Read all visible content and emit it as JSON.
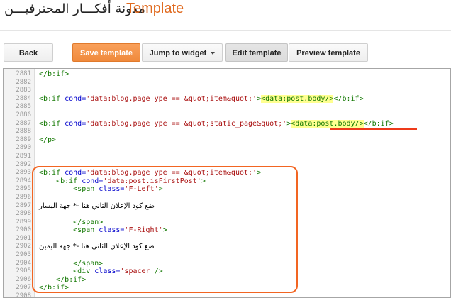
{
  "header": {
    "blog_name": "مدونة أفكـــار المحترفيـــن",
    "separator": "·",
    "page_title": "Template"
  },
  "toolbar": {
    "back_label": "Back",
    "save_label": "Save template",
    "jump_label": "Jump to widget",
    "edit_label": "Edit template",
    "preview_label": "Preview template"
  },
  "editor": {
    "lines": [
      {
        "num": "2881",
        "code": "</b:if>"
      },
      {
        "num": "2882",
        "code": ""
      },
      {
        "num": "2883",
        "code": ""
      },
      {
        "num": "2884",
        "code": "<b:if cond='data:blog.pageType == &quot;item&quot;'><data:post.body/></b:if>"
      },
      {
        "num": "2885",
        "code": ""
      },
      {
        "num": "2886",
        "code": ""
      },
      {
        "num": "2887",
        "code": "<b:if cond='data:blog.pageType == &quot;static_page&quot;'><data:post.body/></b:if>"
      },
      {
        "num": "2888",
        "code": ""
      },
      {
        "num": "2889",
        "code": "</p>"
      },
      {
        "num": "2890",
        "code": ""
      },
      {
        "num": "2891",
        "code": ""
      },
      {
        "num": "2892",
        "code": ""
      },
      {
        "num": "2893",
        "code": "<b:if cond='data:blog.pageType == &quot;item&quot;'>"
      },
      {
        "num": "2894",
        "code": "    <b:if cond='data:post.isFirstPost'>"
      },
      {
        "num": "2895",
        "code": "        <span class='F-Left'>"
      },
      {
        "num": "2896",
        "code": ""
      },
      {
        "num": "2897",
        "code": "ضع كود الإعلان الثاني هنا -* جهة اليسار"
      },
      {
        "num": "2898",
        "code": ""
      },
      {
        "num": "2899",
        "code": "        </span>"
      },
      {
        "num": "2900",
        "code": "        <span class='F-Right'>"
      },
      {
        "num": "2901",
        "code": ""
      },
      {
        "num": "2902",
        "code": "ضع كود الإعلان الثاني هنا -* جهة اليمين"
      },
      {
        "num": "2903",
        "code": ""
      },
      {
        "num": "2904",
        "code": "        </span>"
      },
      {
        "num": "2905",
        "code": "        <div class='spacer'/>"
      },
      {
        "num": "2906",
        "code": "    </b:if>"
      },
      {
        "num": "2907",
        "code": "</b:if>"
      },
      {
        "num": "2908",
        "code": ""
      }
    ]
  },
  "colors": {
    "accent": "#e06a1f",
    "annotation": "#f26522",
    "highlight": "#ffff90"
  }
}
